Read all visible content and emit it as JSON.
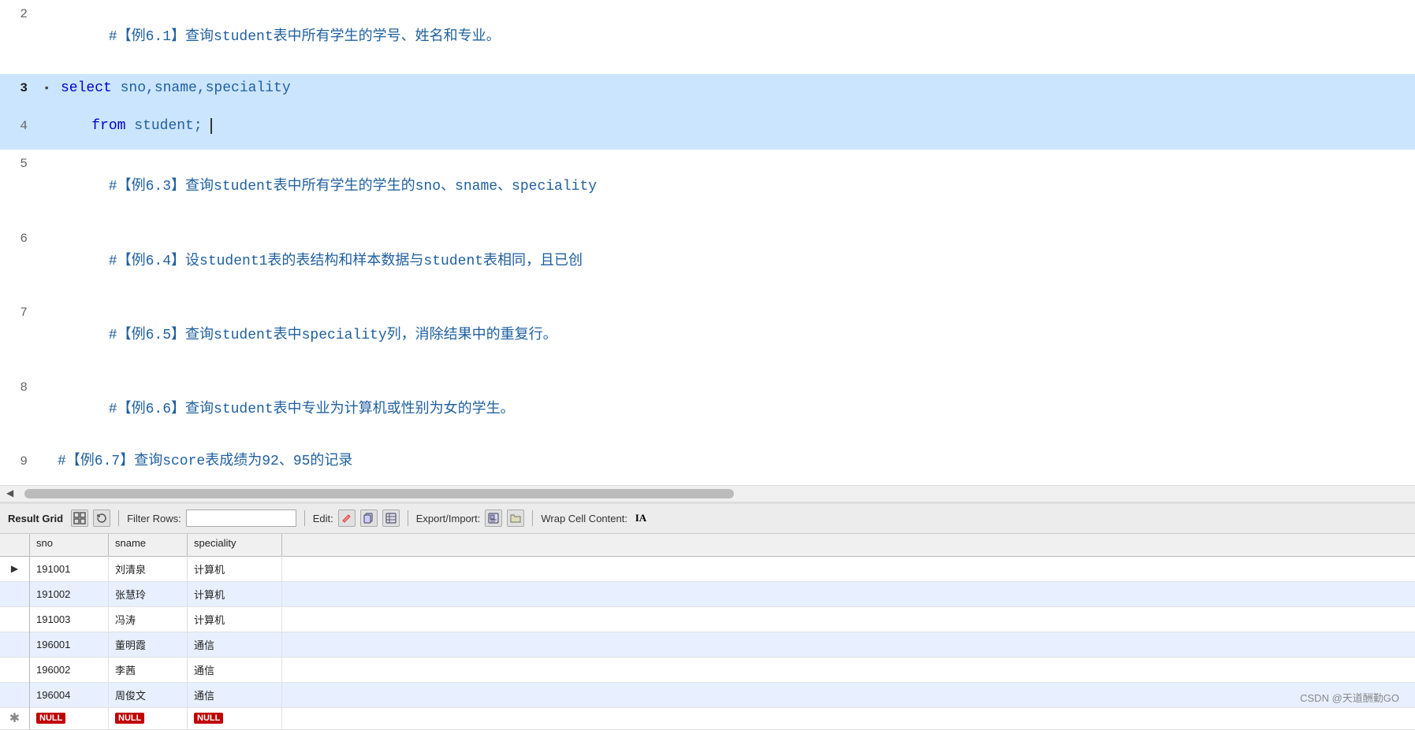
{
  "editor": {
    "lines": [
      {
        "num": "2",
        "bullet": "",
        "highlighted": false,
        "active": false,
        "content": "#【例6.1】查询student表中所有学生的学号、姓名和专业。",
        "type": "comment"
      },
      {
        "num": "3",
        "bullet": "•",
        "highlighted": true,
        "active": true,
        "content": "select sno,sname,speciality",
        "type": "code"
      },
      {
        "num": "4",
        "bullet": "",
        "highlighted": true,
        "active": false,
        "content": "    from student;",
        "type": "code",
        "cursor": true
      },
      {
        "num": "5",
        "bullet": "",
        "highlighted": false,
        "active": false,
        "content": "#【例6.3】查询student表中所有学生的学生的sno、sname、speciality",
        "type": "comment"
      },
      {
        "num": "6",
        "bullet": "",
        "highlighted": false,
        "active": false,
        "content": "#【例6.4】设student1表的表结构和样本数据与student表相同，且已创",
        "type": "comment"
      },
      {
        "num": "7",
        "bullet": "",
        "highlighted": false,
        "active": false,
        "content": "#【例6.5】查询student表中speciality列，消除结果中的重复行。",
        "type": "comment"
      },
      {
        "num": "8",
        "bullet": "",
        "highlighted": false,
        "active": false,
        "content": "#【例6.6】查询student表中专业为计算机或性别为女的学生。",
        "type": "comment"
      },
      {
        "num": "9",
        "bullet": "",
        "highlighted": false,
        "active": false,
        "content": "#【例6.7】查询score表成绩为92、95的记录",
        "type": "comment",
        "partial": true
      }
    ]
  },
  "toolbar": {
    "result_grid_label": "Result Grid",
    "filter_rows_label": "Filter Rows:",
    "filter_placeholder": "",
    "edit_label": "Edit:",
    "export_import_label": "Export/Import:",
    "wrap_cell_label": "Wrap Cell Content:",
    "icons": {
      "grid_icon": "▦",
      "refresh_icon": "↻",
      "edit_pencil": "✏",
      "edit_copy": "⧉",
      "edit_table": "⊞",
      "export_save": "💾",
      "export_folder": "📂",
      "wrap_icon": "A"
    }
  },
  "result_grid": {
    "columns": [
      "sno",
      "sname",
      "speciality"
    ],
    "rows": [
      {
        "marker": "▶",
        "sno": "191001",
        "sname": "刘清泉",
        "speciality": "计算机",
        "alt": false,
        "active": true
      },
      {
        "marker": "",
        "sno": "191002",
        "sname": "张慧玲",
        "speciality": "计算机",
        "alt": true,
        "active": false
      },
      {
        "marker": "",
        "sno": "191003",
        "sname": "冯涛",
        "speciality": "计算机",
        "alt": false,
        "active": false
      },
      {
        "marker": "",
        "sno": "196001",
        "sname": "董明霞",
        "speciality": "通信",
        "alt": true,
        "active": false
      },
      {
        "marker": "",
        "sno": "196002",
        "sname": "李茜",
        "speciality": "通信",
        "alt": false,
        "active": false
      },
      {
        "marker": "",
        "sno": "196004",
        "sname": "周俊文",
        "speciality": "通信",
        "alt": true,
        "active": false
      }
    ],
    "null_row": {
      "sno_null": "NULL",
      "sname_null": "NULL",
      "speciality_null": "NULL"
    }
  },
  "watermark": {
    "text": "CSDN @天道酬勤GO"
  }
}
